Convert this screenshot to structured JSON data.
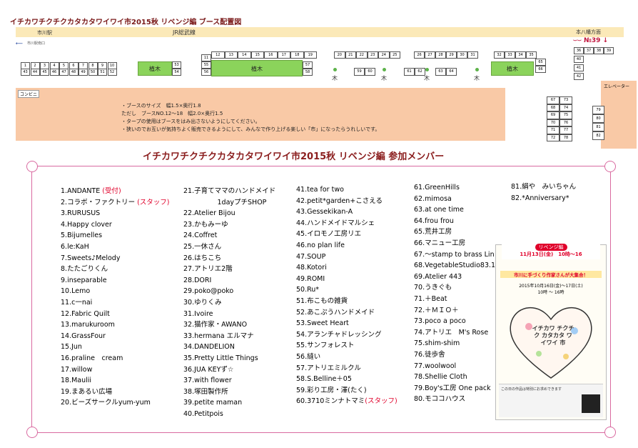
{
  "map": {
    "title": "イチカワチクチクカタカタワイワイ市2015秋 リベンジ編 ブース配置図",
    "rail_left": "市川駅",
    "rail_center": "JR総武線",
    "rail_right": "本八幡方面",
    "arrow_label": "市川駅南口",
    "number_label": "№39",
    "kombini": "コンビニ",
    "elevator": "エレベーター",
    "green_label": "植木",
    "tree_label": "木",
    "info_lines": [
      "・ブースのサイズ　幅1.5×奥行1.8",
      "ただし　ブースNO.12〜18　幅2.0×奥行1.5",
      "・タープの使用はブースをはみ出さないようにしてください。",
      "・狭いのでお互いが気持ちよく販売できるようにして、みんなで作り上げる楽しい「市」になったらうれしいです。"
    ],
    "booths_top_a": [
      "1",
      "2",
      "3",
      "4",
      "5",
      "6",
      "7",
      "8",
      "9",
      "10"
    ],
    "booths_bottom_a": [
      "43",
      "44",
      "45",
      "46",
      "47",
      "48",
      "49",
      "50",
      "51",
      "52"
    ],
    "booths_53_54": [
      "53",
      "54"
    ],
    "booths_top_b": [
      "11",
      "12",
      "13",
      "14",
      "15",
      "16",
      "17",
      "18",
      "19"
    ],
    "booths_side_b": [
      "55",
      "56",
      "57",
      "58"
    ],
    "booths_top_c": [
      "20",
      "21",
      "22",
      "23",
      "24",
      "25"
    ],
    "booths_mid_c": [
      "59",
      "60",
      "61",
      "62",
      "63",
      "64"
    ],
    "booths_top_d": [
      "26",
      "27",
      "28",
      "29",
      "30",
      "31"
    ],
    "booths_top_e": [
      "32",
      "33",
      "34",
      "35"
    ],
    "booths_e_side": [
      "65",
      "66"
    ],
    "booths_f": [
      "36",
      "37",
      "38",
      "39",
      "40",
      "41",
      "42"
    ],
    "booths_g": [
      "67",
      "68",
      "69",
      "70",
      "71",
      "72",
      "73",
      "74",
      "75",
      "76",
      "77",
      "78"
    ],
    "booths_h": [
      "79",
      "80",
      "81",
      "82"
    ]
  },
  "members": {
    "title": "イチカワチクチクカタカタワイワイ市2015秋 リベンジ編 参加メンバー",
    "col1": [
      "1.ANDANTE ",
      "2.コラボ・ファクトリー ",
      "3.RURUSUS",
      "4.Happy clover",
      "5.Bijumelles",
      "6.le:KaH",
      "7.Sweets♪Melody",
      "8.たたごりくん",
      "9.inseparable",
      "10.Lemo",
      "11.c一nai",
      "12.Fabric Quilt",
      "13.marukuroom",
      "14.GrassFour",
      "15.Jun",
      "16.praline　cream",
      "17.willow",
      "18.Maulii",
      "19.まあるい広場",
      "20.ビーズサークルyum-yum"
    ],
    "col1_red": [
      "(受付)",
      "(スタッフ)"
    ],
    "col2": [
      "21.子育てママのハンドメイド",
      "　　　　　1dayプチSHOP",
      "22.Atelier Bijou",
      "23.かもみーゆ",
      "24.Coffret",
      "25.一休さん",
      "26.はちこち",
      "27.アトリエ2階",
      "28.DORI",
      "29.poko@poko",
      "30.ゆりくみ",
      "31.Ivoire",
      "32.猫作家・AWANO",
      "33.hermana エルマナ",
      "34.DANDELION",
      "35.Pretty Little Things",
      "36.JUA KEYず☆",
      "37.with flower",
      "38.塚田製作所",
      "39.petite maman",
      "40.Petitpois"
    ],
    "col3": [
      "41.tea for two",
      "42.petit*garden+こさえる",
      "43.Gessekikan-A",
      "44.ハンドメイドマルシェ",
      "45.イロモノ工房リエ",
      "46.no plan life",
      "47.SOUP",
      "48.Kotori",
      "49.ROMI",
      "50.Ru*",
      "51.布こもの雑貨",
      "52.あこぷうハンドメイド",
      "53.Sweet Heart",
      "54.アランチャドレッシング",
      "55.サンフォレスト",
      "56.縫い",
      "57.アトリエミルクル",
      "58.S.Belline＋05",
      "59.彩り工房・澤(たく)",
      "60.3710ミンナトマミ"
    ],
    "col3_red": "(スタッフ)",
    "col4": [
      "61.GreenHills",
      "62.mimosa",
      "63.at one time",
      "64.frou frou",
      "65.荒井工房",
      "66.マニュー工房",
      "67.〜stamp to brass Lin",
      "68.VegetableStudio83.1",
      "69.Atelier 443",
      "70.うきぐも",
      "71.＋Beat",
      "72.＋ＭＩＯ＋",
      "73.poco a poco",
      "74.アトリエ　M's Rose",
      "75.shim-shim",
      "76.徒歩舎",
      "77.woolwool",
      "78.Shellie Cloth",
      "79.Boy's工房 One pack",
      "80.モココハウス"
    ],
    "col5": [
      "81.絹や　みいちゃん",
      "82.*Anniversary*"
    ]
  },
  "poster": {
    "badge": "リベンジ編",
    "date": "11月13日(金)　10時〜16",
    "headline": "市川に手づくり作家さんが大集合！",
    "sub": "2015年10月16日(金)〜17日(土)",
    "time": "10時 〜 16時",
    "heart_text": "イチカワ チクチク カタカタ ワイワイ 市",
    "footer": "この日の作品は特別にお求めできます"
  },
  "colors": {
    "red": "#e0002a",
    "green": "#8bd35b",
    "peach": "#f9c9a6",
    "cream": "#fbe9b8",
    "pink_border": "#d96aa0"
  }
}
